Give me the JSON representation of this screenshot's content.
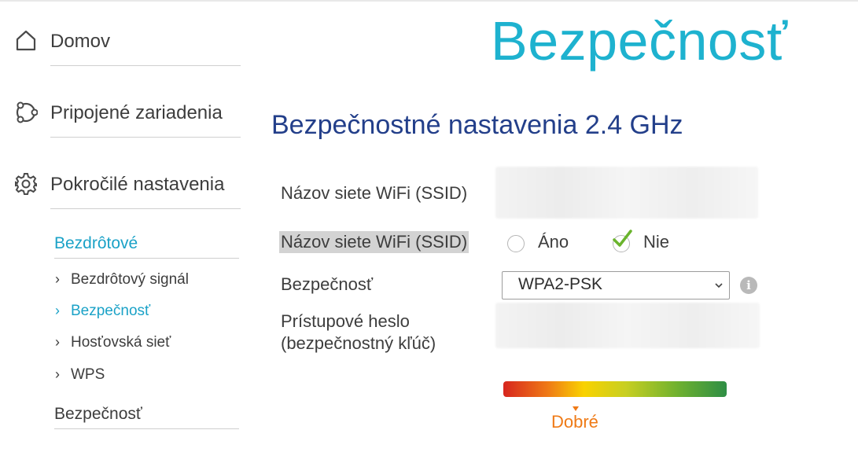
{
  "sidebar": {
    "home": {
      "label": "Domov",
      "icon": "home-icon"
    },
    "devices": {
      "label": "Pripojené zariadenia",
      "icon": "devices-icon"
    },
    "advanced": {
      "label": "Pokročilé nastavenia",
      "icon": "gear-icon"
    },
    "wireless_section": "Bezdrôtové",
    "wireless_items": [
      {
        "label": "Bezdrôtový signál",
        "active": false
      },
      {
        "label": "Bezpečnosť",
        "active": true
      },
      {
        "label": "Hosťovská sieť",
        "active": false
      },
      {
        "label": "WPS",
        "active": false
      }
    ],
    "security_section": "Bezpečnosť"
  },
  "main": {
    "page_title": "Bezpečnosť",
    "section_title": "Bezpečnostné nastavenia 2.4 GHz",
    "ssid_label": "Názov siete WiFi (SSID)",
    "hide_ssid_label": "Názov siete WiFi (SSID)",
    "hide_ssid_options": {
      "yes": "Áno",
      "no": "Nie",
      "selected": "no"
    },
    "security_label": "Bezpečnosť",
    "security_value": "WPA2-PSK",
    "password_label_line1": "Prístupové heslo",
    "password_label_line2": "(bezpečnostný kľúč)",
    "strength_label": "Dobré",
    "info_symbol": "i"
  },
  "colors": {
    "accent": "#1ba2c7",
    "title": "#1eb2cf",
    "heading": "#233f8a",
    "strength": "#ef7a16"
  }
}
